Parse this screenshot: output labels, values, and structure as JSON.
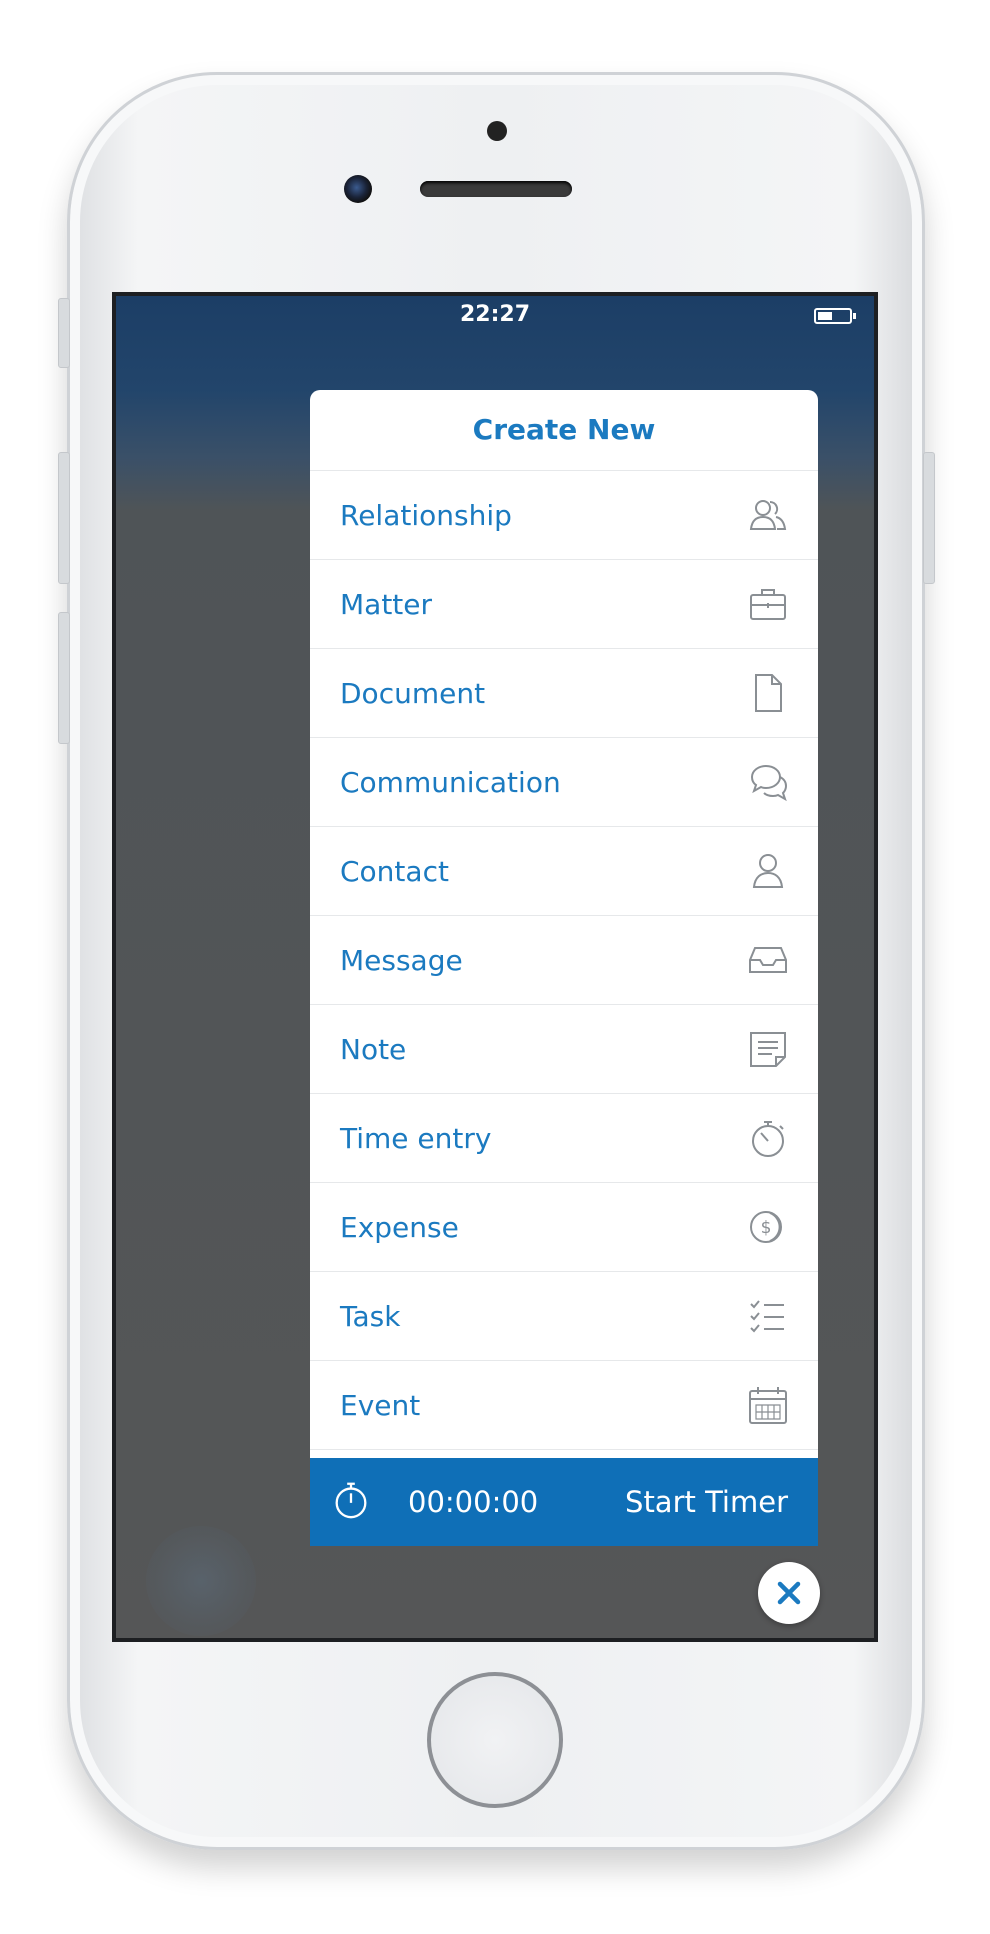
{
  "status_bar": {
    "time": "22:27"
  },
  "menu": {
    "title": "Create New",
    "items": [
      {
        "label": "Relationship",
        "icon": "people-icon"
      },
      {
        "label": "Matter",
        "icon": "briefcase-icon"
      },
      {
        "label": "Document",
        "icon": "document-icon"
      },
      {
        "label": "Communication",
        "icon": "chat-bubbles-icon"
      },
      {
        "label": "Contact",
        "icon": "person-icon"
      },
      {
        "label": "Message",
        "icon": "inbox-icon"
      },
      {
        "label": "Note",
        "icon": "note-icon"
      },
      {
        "label": "Time entry",
        "icon": "stopwatch-icon"
      },
      {
        "label": "Expense",
        "icon": "dollar-coin-icon"
      },
      {
        "label": "Task",
        "icon": "checklist-icon"
      },
      {
        "label": "Event",
        "icon": "calendar-icon"
      }
    ]
  },
  "timer": {
    "value": "00:00:00",
    "start_label": "Start Timer",
    "icon": "stopwatch-icon"
  },
  "close": {
    "icon": "close-icon"
  },
  "colors": {
    "accent": "#1b7ac0",
    "timer_bar": "#0f6fb7",
    "close_x": "#1b7ac0"
  }
}
